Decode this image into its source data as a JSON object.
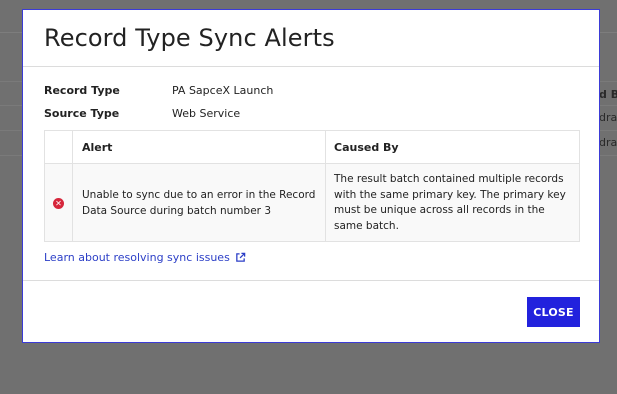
{
  "background": {
    "header_fragment": "d By",
    "row_fragments": [
      "dra",
      "dra"
    ]
  },
  "dialog": {
    "title": "Record Type Sync Alerts",
    "fields": [
      {
        "label": "Record Type",
        "value": "PA SapceX Launch"
      },
      {
        "label": "Source Type",
        "value": "Web Service"
      }
    ],
    "alerts_table": {
      "columns": [
        "Alert",
        "Caused By"
      ],
      "rows": [
        {
          "status": "error",
          "status_icon": "error-circle-icon",
          "alert": "Unable to sync due to an error in the Record Data Source during batch number 3",
          "caused_by": "The result batch contained multiple records with the same primary key. The primary key must be unique across all records in the same batch."
        }
      ]
    },
    "help_link": "Learn about resolving sync issues",
    "help_link_icon": "external-link-icon",
    "close_label": "CLOSE"
  },
  "colors": {
    "accent": "#2222dd",
    "link": "#2c3fc7",
    "error": "#d6263b",
    "overlay": "#707070"
  }
}
